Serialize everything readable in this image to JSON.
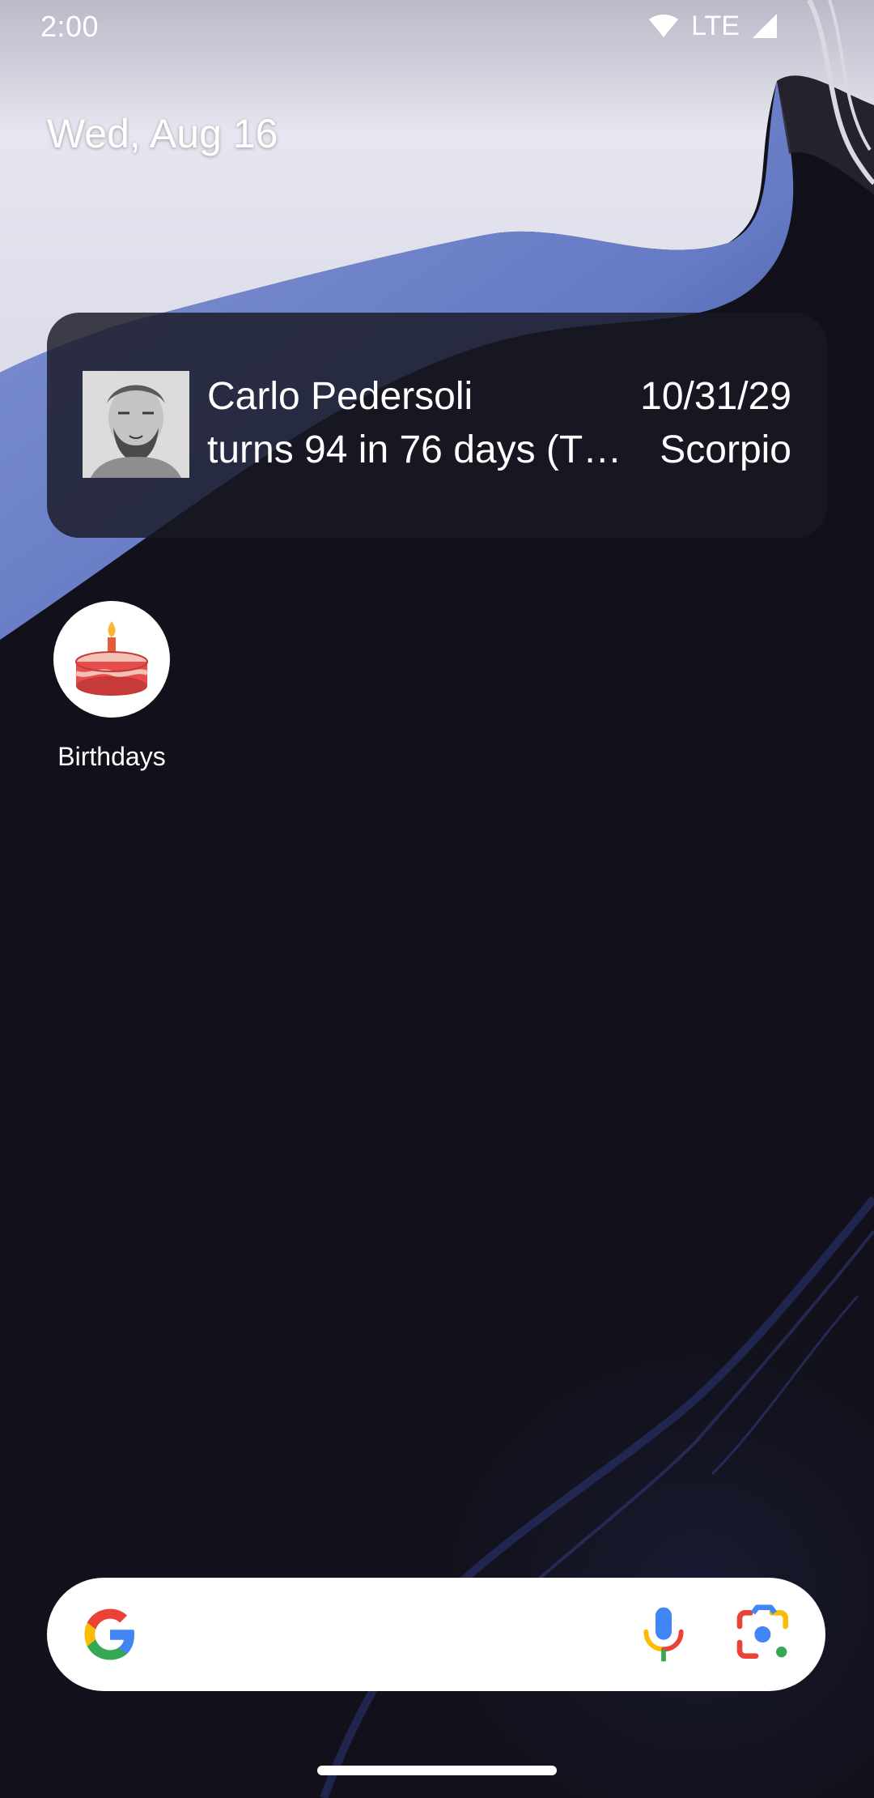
{
  "status_bar": {
    "time": "2:00",
    "network": "LTE",
    "icons": [
      "wifi-icon",
      "signal-icon"
    ]
  },
  "home": {
    "date": "Wed, Aug 16"
  },
  "widget": {
    "name": "Carlo Pedersoli",
    "subtitle": "turns 94 in 76 days (T…",
    "birth_date": "10/31/29",
    "zodiac": "Scorpio"
  },
  "apps": [
    {
      "label": "Birthdays",
      "icon": "birthday-cake-icon"
    }
  ],
  "search_bar": {
    "icons": [
      "google-g-icon",
      "microphone-icon",
      "google-lens-icon"
    ]
  },
  "colors": {
    "widget_bg": "#181824",
    "search_bg": "#ffffff",
    "google_blue": "#4285F4",
    "google_red": "#EA4335",
    "google_yellow": "#FBBC05",
    "google_green": "#34A853"
  }
}
